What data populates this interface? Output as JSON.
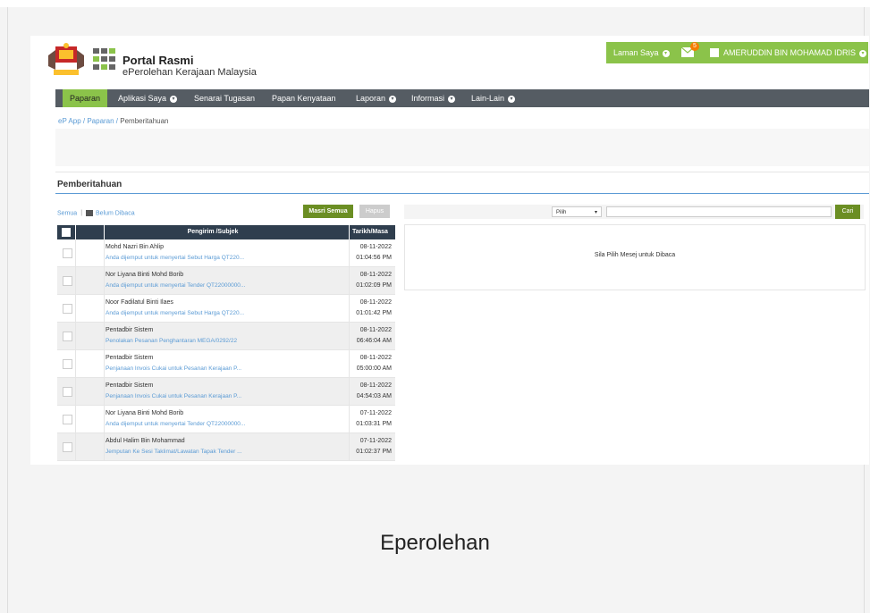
{
  "header": {
    "portal_title": "Portal Rasmi",
    "portal_subtitle": "ePerolehan Kerajaan Malaysia",
    "laman_saya": "Laman Saya",
    "mail_badge": "5",
    "user_name": "AMERUDDIN BIN MOHAMAD IDRIS"
  },
  "nav": {
    "items": [
      "Paparan",
      "Aplikasi Saya",
      "Senarai Tugasan",
      "Papan Kenyataan",
      "Laporan",
      "Informasi",
      "Lain-Lain"
    ]
  },
  "breadcrumb": {
    "ep_app": "eP App",
    "paparan": "Paparan",
    "current": "Pemberitahuan",
    "sep": " / "
  },
  "panel": {
    "title": "Pemberitahuan",
    "filter_all": "Semua",
    "filter_sep": "|",
    "filter_unread": "Belum Dibaca",
    "btn_mark_all": "Masri Semua",
    "btn_delete": "Hapus"
  },
  "table": {
    "header_subject": "Pengirim /Subjek",
    "header_date": "Tarikh/Masa",
    "rows": [
      {
        "sender": "Mohd Nazri Bin Ahlip",
        "subject": "Anda dijemput untuk menyertai Sebut Harga QT220...",
        "date": "08-11-2022",
        "time": "01:04:56 PM"
      },
      {
        "sender": "Nor Liyana Binti Mohd Borib",
        "subject": "Anda dijemput untuk menyertai Tender QT22000000...",
        "date": "08-11-2022",
        "time": "01:02:09 PM"
      },
      {
        "sender": "Noor Fadilatul Binti Ilaes",
        "subject": "Anda dijemput untuk menyertai Sebut Harga QT220...",
        "date": "08-11-2022",
        "time": "01:01:42 PM"
      },
      {
        "sender": "Pentadbir Sistem",
        "subject": "Penolakan Pesanan Penghantaran MEGA/0292/22",
        "date": "08-11-2022",
        "time": "06:46:04 AM"
      },
      {
        "sender": "Pentadbir Sistem",
        "subject": "Penjanaan Invois Cukai untuk Pesanan Kerajaan P...",
        "date": "08-11-2022",
        "time": "05:00:00 AM"
      },
      {
        "sender": "Pentadbir Sistem",
        "subject": "Penjanaan Invois Cukai untuk Pesanan Kerajaan P...",
        "date": "08-11-2022",
        "time": "04:54:03 AM"
      },
      {
        "sender": "Nor Liyana Binti Mohd Borib",
        "subject": "Anda dijemput untuk menyertai Tender QT22000000...",
        "date": "07-11-2022",
        "time": "01:03:31 PM"
      },
      {
        "sender": "Abdul Halim Bin Mohammad",
        "subject": "Jemputan Ke Sesi Taklimat/Lawatan Tapak Tender ...",
        "date": "07-11-2022",
        "time": "01:02:37 PM"
      }
    ]
  },
  "search": {
    "select_value": "Pilih",
    "btn_search": "Cari"
  },
  "message_box": {
    "placeholder": "Sila Pilih Mesej untuk Dibaca"
  },
  "caption": "Eperolehan",
  "colors": {
    "accent_green": "#8bc34a",
    "nav_gray": "#555c63",
    "table_header": "#2f3e4e",
    "link_blue": "#5b9bd5",
    "button_olive": "#6b8e23"
  }
}
